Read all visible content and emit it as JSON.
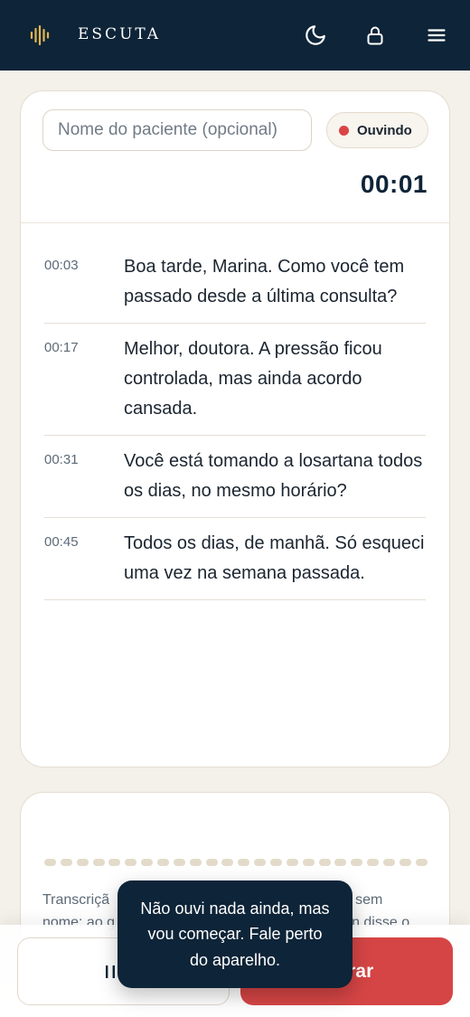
{
  "header": {
    "brand": "ESCUTA",
    "logo_icon": "soundwave-icon",
    "theme_icon": "moon-icon",
    "lock_icon": "lock-icon",
    "menu_icon": "hamburger-menu-icon",
    "background_color": "#0e2438",
    "logo_color": "#e2b650"
  },
  "session": {
    "patient_placeholder": "Nome do paciente (opcional)",
    "patient_value": "",
    "status_label": "Ouvindo",
    "status_color": "#d94545",
    "timer": "00:01"
  },
  "transcript": [
    {
      "time": "00:03",
      "text": "Boa tarde, Marina. Como você tem passado desde a última consulta?"
    },
    {
      "time": "00:17",
      "text": "Melhor, doutora. A pressão ficou controlada, mas ainda acordo cansada."
    },
    {
      "time": "00:31",
      "text": "Você está tomando a losartana todos os dias, no mesmo horário?"
    },
    {
      "time": "00:45",
      "text": "Todos os dias, de manhã. Só esqueci uma vez na semana passada."
    }
  ],
  "audio_panel": {
    "caption_visible_fragments": [
      "Transcriçã",
      "sem",
      "nome: ao g",
      "n disse o"
    ]
  },
  "actions": {
    "pause_label": "P",
    "pause_icon": "pause-icon",
    "stop_label": "cerrar",
    "stop_color": "#d64545"
  },
  "toast": {
    "message": "Não ouvi nada ainda, mas vou começar. Fale perto do aparelho."
  }
}
